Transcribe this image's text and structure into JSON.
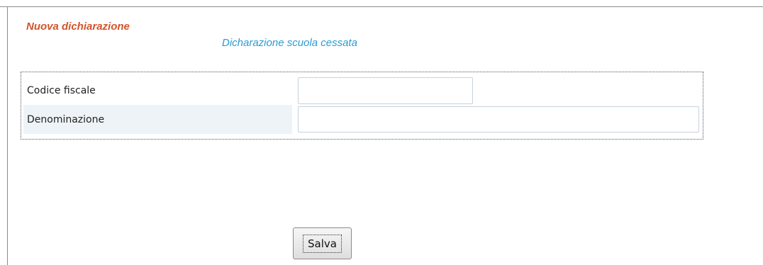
{
  "header": {
    "title": "Nuova dichiarazione",
    "subtitle": "Dicharazione scuola cessata"
  },
  "form": {
    "fields": [
      {
        "label": "Codice fiscale",
        "value": "",
        "placeholder": ""
      },
      {
        "label": "Denominazione",
        "value": "",
        "placeholder": ""
      }
    ],
    "save_label": "Salva"
  },
  "colors": {
    "title": "#d2542a",
    "subtitle": "#2a9bd3",
    "label_highlight": "#eef3f7"
  }
}
